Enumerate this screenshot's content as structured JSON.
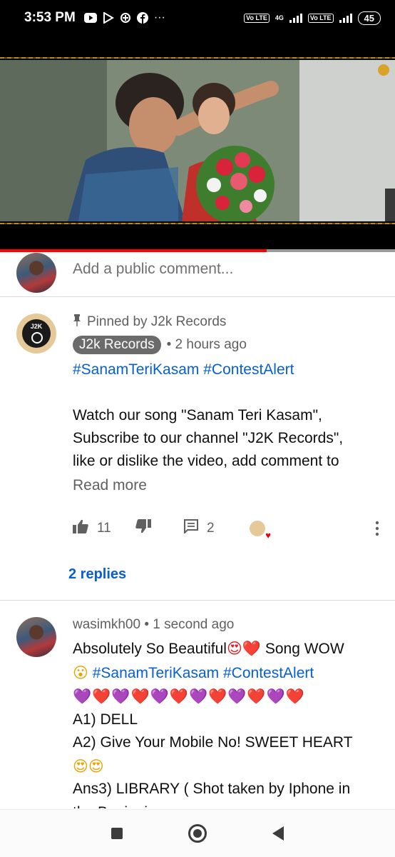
{
  "status_bar": {
    "time": "3:53 PM",
    "battery": "45",
    "volte_labels": [
      "Vo LTE",
      "Vo LTE"
    ],
    "network": "4G",
    "more": "···"
  },
  "video": {
    "progress_fraction": 0.675,
    "progress_color": "#ff0000"
  },
  "add_comment": {
    "placeholder": "Add a public comment..."
  },
  "pinned_comment": {
    "pinned_label": "Pinned by J2k Records",
    "channel": "J2k Records",
    "time": "• 2 hours ago",
    "avatar_text": "J2K",
    "hashtags": "#SanamTeriKasam #ContestAlert",
    "body_lines": [
      "Watch our song \"Sanam Teri Kasam\",",
      "Subscribe to our channel \"J2K Records\",",
      "like or dislike the video, add comment to"
    ],
    "read_more": "Read more",
    "likes": "11",
    "reply_count": "2",
    "replies_link": "2 replies"
  },
  "user_comment": {
    "author": "wasimkh00",
    "time": "• 1 second ago",
    "line1_a": "Absolutely So Beautiful",
    "line1_emoji": "😍❤️",
    "line1_b": " Song WOW",
    "line2_emoji": "😮",
    "line2_hashtags": " #SanamTeriKasam #ContestAlert",
    "hearts": [
      "💜",
      "❤️",
      "💜",
      "❤️",
      "💜",
      "❤️",
      "💜",
      "❤️",
      "💜",
      "❤️",
      "💜",
      "❤️"
    ],
    "a1": "A1) DELL",
    "a2": "A2) Give Your Mobile No! SWEET HEART",
    "a2_emoji": "😍😍",
    "a3": "Ans3) LIBRARY ( Shot taken by Iphone in",
    "a3_cont": "the Beginning"
  },
  "colors": {
    "link_blue": "#065fd4",
    "chip_gray": "#6b6b6b",
    "secondary_text": "#606060"
  },
  "icons": {
    "like": "thumbs-up-icon",
    "dislike": "thumbs-down-icon",
    "reply": "comment-icon",
    "pin": "pin-icon",
    "more": "more-vertical-icon"
  }
}
